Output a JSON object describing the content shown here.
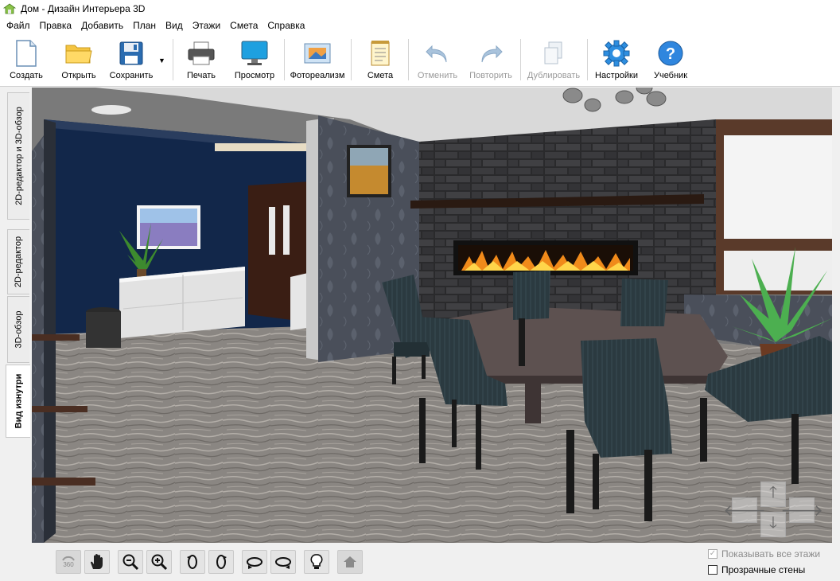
{
  "window": {
    "title": "Дом - Дизайн Интерьера 3D"
  },
  "menu": [
    "Файл",
    "Правка",
    "Добавить",
    "План",
    "Вид",
    "Этажи",
    "Смета",
    "Справка"
  ],
  "toolbar": {
    "create": "Создать",
    "open": "Открыть",
    "save": "Сохранить",
    "print": "Печать",
    "preview": "Просмотр",
    "photoreal": "Фотореализм",
    "estimate": "Смета",
    "undo": "Отменить",
    "redo": "Повторить",
    "duplicate": "Дублировать",
    "settings": "Настройки",
    "tutorial": "Учебник"
  },
  "side_tabs": [
    "2D-редактор и 3D-обзор",
    "2D-редактор",
    "3D-обзор",
    "Вид изнутри"
  ],
  "active_side_tab": "Вид изнутри",
  "bottom": {
    "show_all_floors": "Показывать все этажи",
    "show_all_floors_checked": true,
    "show_all_floors_disabled": true,
    "transparent_walls": "Прозрачные стены",
    "transparent_walls_checked": false
  },
  "bottom_tools": [
    "360-icon",
    "hand-icon",
    "zoom-out-icon",
    "zoom-in-icon",
    "rotate-left-icon",
    "rotate-right-icon",
    "orbit-left-icon",
    "orbit-right-icon",
    "light-bulb-icon",
    "home-icon"
  ]
}
